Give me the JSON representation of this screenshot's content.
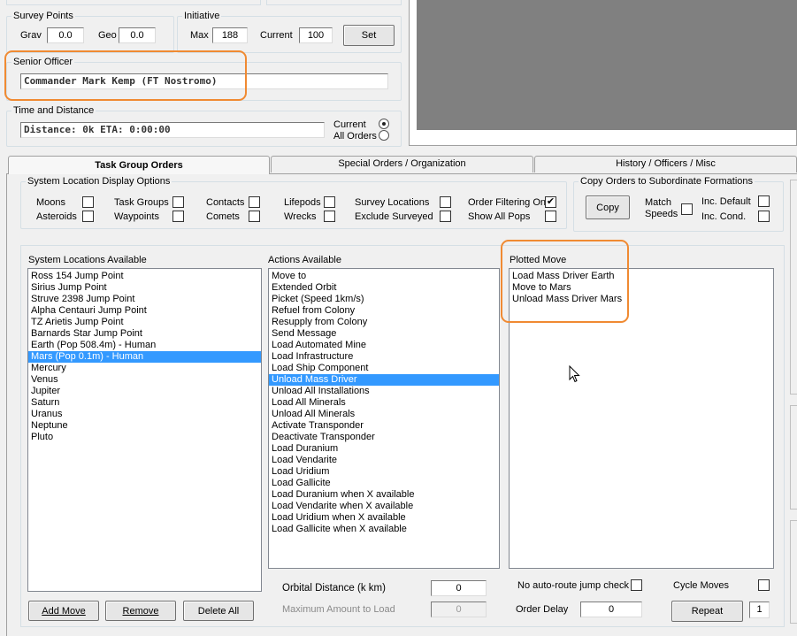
{
  "survey_points": {
    "title": "Survey Points",
    "grav_label": "Grav",
    "grav_value": "0.0",
    "geo_label": "Geo",
    "geo_value": "0.0"
  },
  "initiative": {
    "title": "Initiative",
    "max_label": "Max",
    "max_value": "188",
    "current_label": "Current",
    "current_value": "100",
    "set_button": "Set"
  },
  "senior_officer": {
    "title": "Senior Officer",
    "value": "Commander Mark Kemp (FT Nostromo)"
  },
  "time_distance": {
    "title": "Time and Distance",
    "value": "Distance: 0k  ETA: 0:00:00",
    "current_label": "Current",
    "all_orders_label": "All Orders",
    "selected": "current"
  },
  "tabs": [
    {
      "label": "Task Group Orders",
      "active": true
    },
    {
      "label": "Special Orders / Organization",
      "active": false
    },
    {
      "label": "History / Officers / Misc",
      "active": false
    }
  ],
  "display_options": {
    "title": "System Location Display Options",
    "items": [
      {
        "label": "Moons",
        "checked": false
      },
      {
        "label": "Asteroids",
        "checked": false
      },
      {
        "label": "Task Groups",
        "checked": false
      },
      {
        "label": "Waypoints",
        "checked": false
      },
      {
        "label": "Contacts",
        "checked": false
      },
      {
        "label": "Comets",
        "checked": false
      },
      {
        "label": "Lifepods",
        "checked": false
      },
      {
        "label": "Wrecks",
        "checked": false
      },
      {
        "label": "Survey Locations",
        "checked": false
      },
      {
        "label": "Exclude Surveyed",
        "checked": false
      },
      {
        "label": "Order Filtering On",
        "checked": true
      },
      {
        "label": "Show All Pops",
        "checked": false
      }
    ]
  },
  "copy_orders": {
    "title": "Copy Orders to Subordinate Formations",
    "copy_button": "Copy",
    "match_speeds_label": "Match Speeds",
    "inc_default_label": "Inc. Default",
    "inc_cond_label": "Inc. Cond."
  },
  "system_locations": {
    "title": "System Locations Available",
    "items": [
      "Ross 154 Jump Point",
      "Sirius Jump Point",
      "Struve 2398 Jump Point",
      "Alpha Centauri Jump Point",
      "TZ Arietis Jump Point",
      "Barnards Star Jump Point",
      "Earth  (Pop 508.4m) - Human",
      "Mars  (Pop 0.1m) - Human",
      "Mercury",
      "Venus",
      "Jupiter",
      "Saturn",
      "Uranus",
      "Neptune",
      "Pluto"
    ],
    "selected_index": 7
  },
  "actions": {
    "title": "Actions Available",
    "items": [
      "Move to",
      "Extended Orbit",
      "Picket (Speed 1km/s)",
      "Refuel from Colony",
      "Resupply from Colony",
      "Send Message",
      "Load Automated Mine",
      "Load Infrastructure",
      "Load Ship Component",
      "Unload Mass Driver",
      "Unload All Installations",
      "Load All Minerals",
      "Unload All Minerals",
      "Activate Transponder",
      "Deactivate Transponder",
      "Load Duranium",
      "Load Vendarite",
      "Load Uridium",
      "Load Gallicite",
      "Load Duranium when X available",
      "Load Vendarite when X available",
      "Load Uridium when X available",
      "Load Gallicite when X available"
    ],
    "selected_index": 9
  },
  "plotted_move": {
    "title": "Plotted Move",
    "items": [
      "Load Mass Driver Earth",
      "Move to Mars",
      "Unload Mass Driver Mars"
    ]
  },
  "bottom": {
    "add_move": "Add Move",
    "remove": "Remove",
    "delete_all": "Delete All",
    "orbital_distance_label": "Orbital Distance (k km)",
    "orbital_distance_value": "0",
    "max_amount_label": "Maximum Amount to Load",
    "max_amount_value": "0",
    "no_auto_route_label": "No auto-route jump check",
    "order_delay_label": "Order Delay",
    "order_delay_value": "0",
    "cycle_moves_label": "Cycle Moves",
    "repeat_button": "Repeat",
    "repeat_value": "1"
  },
  "colors": {
    "highlight": "#f08a32",
    "selection": "#3399ff",
    "map_panel": "#808080"
  }
}
